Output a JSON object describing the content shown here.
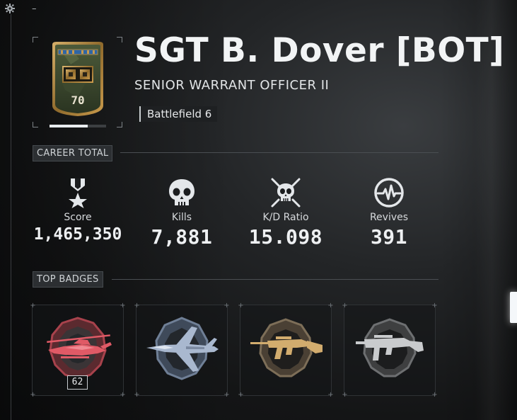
{
  "player": {
    "name": "SGT B. Dover [BOT]",
    "rank_title": "SENIOR WARRANT OFFICER II",
    "rank_level": "70",
    "game": "Battlefield 6",
    "xp_progress_fraction": 0.68
  },
  "toolbar": {
    "dash_label": "–",
    "settings_icon": "gear-icon"
  },
  "career": {
    "heading": "CAREER TOTAL",
    "stats": [
      {
        "label": "Score",
        "value": "1,465,350",
        "icon": "medal-star-icon"
      },
      {
        "label": "Kills",
        "value": "7,881",
        "icon": "skull-icon"
      },
      {
        "label": "K/D Ratio",
        "value": "15.098",
        "icon": "crossed-skull-icon"
      },
      {
        "label": "Revives",
        "value": "391",
        "icon": "heartbeat-icon"
      }
    ]
  },
  "badges": {
    "heading": "TOP BADGES",
    "items": [
      {
        "icon": "attack-helicopter-badge-icon",
        "count": "62",
        "color": "#d84a55"
      },
      {
        "icon": "jet-fighter-badge-icon",
        "color": "#8fa2bd"
      },
      {
        "icon": "assault-rifle-badge-icon",
        "color": "#c8a36a"
      },
      {
        "icon": "smg-badge-icon",
        "color": "#9b9d9f"
      }
    ]
  },
  "colors": {
    "accent_text": "#f2f4f5",
    "rank_emblem_gold": "#b58a3c",
    "rank_emblem_green": "#3c4a2e"
  }
}
